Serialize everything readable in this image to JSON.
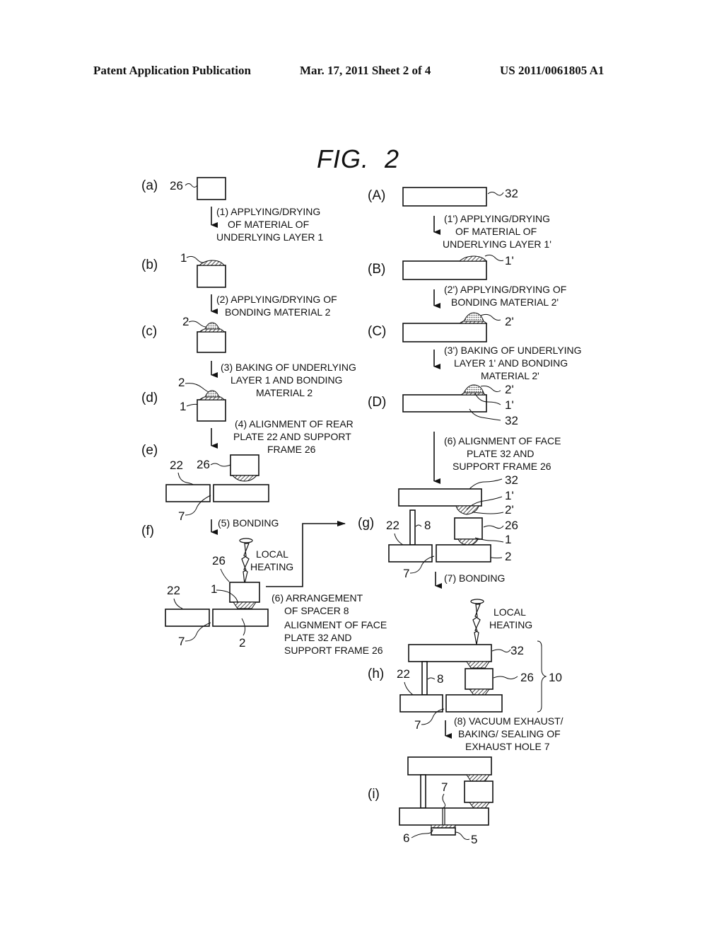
{
  "header": {
    "left": "Patent Application Publication",
    "middle": "Mar. 17, 2011  Sheet 2 of 4",
    "right": "US 2011/0061805 A1"
  },
  "figure": {
    "title": "FIG.  2"
  },
  "left_column": {
    "panels": {
      "a": "(a)",
      "b": "(b)",
      "c": "(c)",
      "d": "(d)",
      "e": "(e)",
      "f": "(f)"
    },
    "steps": {
      "s1": [
        "(1) APPLYING/DRYING",
        "OF MATERIAL OF",
        "UNDERLYING LAYER 1"
      ],
      "s2": [
        "(2) APPLYING/DRYING OF",
        "BONDING MATERIAL 2"
      ],
      "s3": [
        "(3) BAKING OF UNDERLYING",
        "LAYER 1 AND BONDING",
        "MATERIAL 2"
      ],
      "s4": [
        "(4) ALIGNMENT OF REAR",
        "PLATE 22 AND SUPPORT",
        "FRAME 26"
      ],
      "s5": [
        "(5) BONDING"
      ],
      "s6": [
        "(6) ARRANGEMENT",
        "OF SPACER 8",
        "ALIGNMENT OF FACE",
        "PLATE 32 AND",
        "SUPPORT FRAME 26"
      ]
    },
    "local_heating": [
      "LOCAL",
      "HEATING"
    ]
  },
  "right_column": {
    "panels": {
      "A": "(A)",
      "B": "(B)",
      "C": "(C)",
      "D": "(D)",
      "g": "(g)",
      "h": "(h)",
      "i": "(i)"
    },
    "steps": {
      "s1p": [
        "(1') APPLYING/DRYING",
        "OF MATERIAL OF",
        "UNDERLYING LAYER 1'"
      ],
      "s2p": [
        "(2') APPLYING/DRYING OF",
        "BONDING MATERIAL 2'"
      ],
      "s3p": [
        "(3') BAKING OF UNDERLYING",
        "LAYER 1' AND BONDING",
        "MATERIAL 2'"
      ],
      "s6": [
        "(6) ALIGNMENT OF FACE",
        "PLATE 32 AND",
        "SUPPORT FRAME 26"
      ],
      "s7": [
        "(7) BONDING"
      ],
      "s8": [
        "(8) VACUUM EXHAUST/",
        "BAKING/ SEALING OF",
        "EXHAUST HOLE 7"
      ]
    },
    "local_heating": [
      "LOCAL",
      "HEATING"
    ]
  },
  "refs": {
    "support_frame": "26",
    "underlying_layer": "1",
    "bonding_material": "2",
    "underlying_layer_p": "1'",
    "bonding_material_p": "2'",
    "face_plate": "32",
    "rear_plate": "22",
    "exhaust_hole": "7",
    "spacer": "8",
    "panel_assembly": "10",
    "seal_6": "6",
    "seal_5": "5"
  }
}
